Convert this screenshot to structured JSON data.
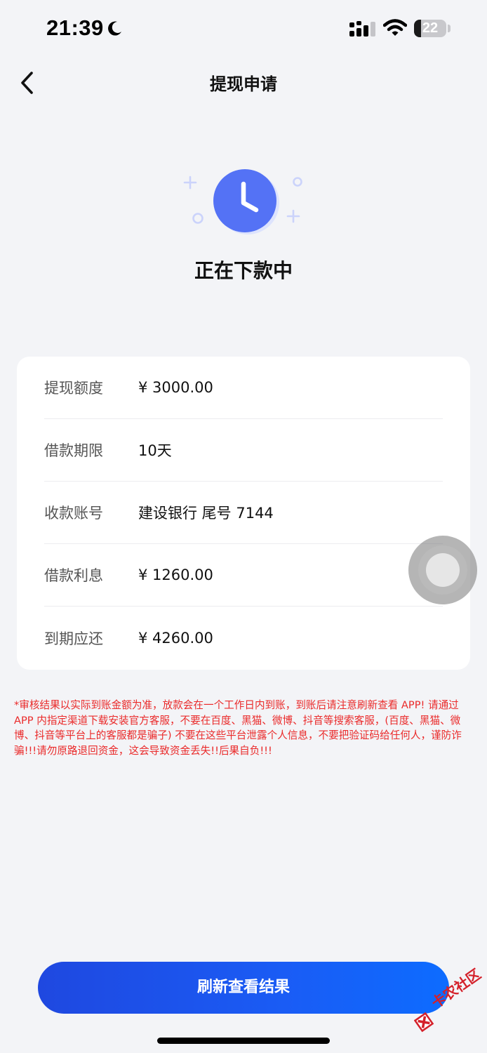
{
  "status_bar": {
    "time": "21:39",
    "battery_level": "22",
    "battery_fraction": 0.22,
    "icons": [
      "moon-icon",
      "signal-icon",
      "wifi-icon",
      "battery-icon"
    ]
  },
  "nav": {
    "title": "提现申请",
    "back_icon": "chevron-left-icon"
  },
  "status": {
    "icon": "clock-icon",
    "text": "正在下款中",
    "accent_color": "#5472f5"
  },
  "info": {
    "rows": [
      {
        "label": "提现额度",
        "value": "¥ 3000.00"
      },
      {
        "label": "借款期限",
        "value": "10天"
      },
      {
        "label": "收款账号",
        "value": "建设银行 尾号 7144"
      },
      {
        "label": "借款利息",
        "value": "¥ 1260.00"
      },
      {
        "label": "到期应还",
        "value": "¥ 4260.00"
      }
    ]
  },
  "notice": {
    "text": "*审核结果以实际到账金额为准，放款会在一个工作日内到账，到账后请注意刷新查看 APP! 请通过 APP 内指定渠道下载安装官方客服，不要在百度、黑猫、微博、抖音等搜索客服，(百度、黑猫、微博、抖音等平台上的客服都是骗子) 不要在这些平台泄露个人信息，不要把验证码给任何人，谨防诈骗!!!请勿原路退回资金，这会导致资金丢失!!后果自负!!!",
    "color": "#ea2a2a"
  },
  "actions": {
    "refresh_label": "刷新查看结果",
    "button_color": "#1a5cf5"
  },
  "watermark": {
    "text": "卡农社区"
  }
}
